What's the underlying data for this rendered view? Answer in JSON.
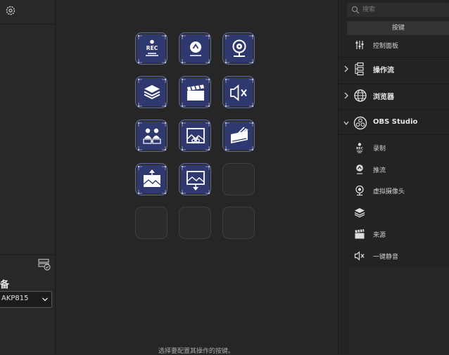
{
  "left": {
    "device_label": "备",
    "device_value": "AKP815"
  },
  "right": {
    "search_placeholder": "搜索",
    "tab_label": "按键",
    "partial_item_label": "控制面板",
    "categories": [
      {
        "label": "操作流",
        "expanded": false
      },
      {
        "label": "浏览器",
        "expanded": false
      },
      {
        "label": "OBS Studio",
        "expanded": true
      }
    ],
    "obs_items": [
      {
        "label": "录制",
        "icon": "rec-icon"
      },
      {
        "label": "推流",
        "icon": "stream-icon"
      },
      {
        "label": "虚拟摄像头",
        "icon": "webcam-icon"
      },
      {
        "label": "",
        "icon": "layers-icon"
      },
      {
        "label": "来源",
        "icon": "clapperboard-icon"
      },
      {
        "label": "一键静音",
        "icon": "mute-icon"
      }
    ]
  },
  "canvas": {
    "hint": "选择要配置其操作的按键。"
  },
  "keys": [
    {
      "id": "key-1",
      "filled": true,
      "icon": "rec-icon",
      "text": "REC"
    },
    {
      "id": "key-2",
      "filled": true,
      "icon": "stream-icon"
    },
    {
      "id": "key-3",
      "filled": true,
      "icon": "webcam-icon"
    },
    {
      "id": "key-4",
      "filled": true,
      "icon": "layers-icon"
    },
    {
      "id": "key-5",
      "filled": true,
      "icon": "clapperboard-icon"
    },
    {
      "id": "key-6",
      "filled": true,
      "icon": "mute-icon"
    },
    {
      "id": "key-7",
      "filled": true,
      "icon": "scene-switch-icon"
    },
    {
      "id": "key-8",
      "filled": true,
      "icon": "scene-cut-icon"
    },
    {
      "id": "key-9",
      "filled": true,
      "icon": "transition-icon"
    },
    {
      "id": "key-10",
      "filled": true,
      "icon": "scene-move-up-icon"
    },
    {
      "id": "key-11",
      "filled": true,
      "icon": "scene-move-down-icon"
    },
    {
      "id": "key-12",
      "filled": false
    },
    {
      "id": "key-13",
      "filled": false
    },
    {
      "id": "key-14",
      "filled": false
    },
    {
      "id": "key-15",
      "filled": false
    }
  ],
  "colors": {
    "key_fill": "#2f3970",
    "key_border": "#5d689f",
    "bg": "#262626",
    "panel": "#232323"
  }
}
